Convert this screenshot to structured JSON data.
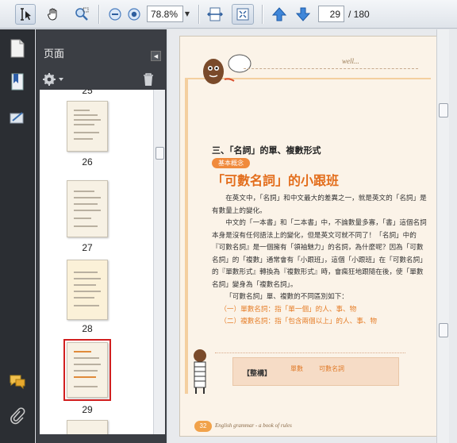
{
  "toolbar": {
    "zoom": "78.8%",
    "current_page": "29",
    "total_pages": "/ 180"
  },
  "panel": {
    "title": "页面"
  },
  "thumbnails": [
    {
      "label": "25"
    },
    {
      "label": "26"
    },
    {
      "label": "27"
    },
    {
      "label": "28"
    },
    {
      "label": "29"
    }
  ],
  "document": {
    "brand": "well...",
    "section_heading": "三、「名詞」的單、複數形式",
    "tag": "基本概念",
    "title": "「可數名詞」的小跟班",
    "paragraphs": [
      "在英文中，「名詞」和中文最大的差異之一，就是英文的「名詞」是有數量上的變化。",
      "中文的「一本書」和「二本書」中，不論數量多寡，「書」這個名詞本身是沒有任何語法上的變化，但是英文可就不同了！「名詞」中的『可數名詞』是一個擁有「領袖魅力」的名詞，為什麼呢？因為「可數名詞」的「複數」通常會有「小跟班」，這個「小跟班」在「可數名詞」的『單數形式』轉換為『複數形式』時，會瘋狂地跟隨在後，使「單數名詞」變身為「複數名詞」。",
      "「可數名詞」單、複數的不同區別如下："
    ],
    "list": [
      "（一）單數名詞：指「單一個」的人、事、物",
      "（二）複數名詞：指「包含兩個以上」的人、事、物"
    ],
    "note_label": "【整構】",
    "note_col1": "單數",
    "note_col2": "可數名詞",
    "page_number": "32",
    "footer": "English grammar - a book of rules"
  }
}
